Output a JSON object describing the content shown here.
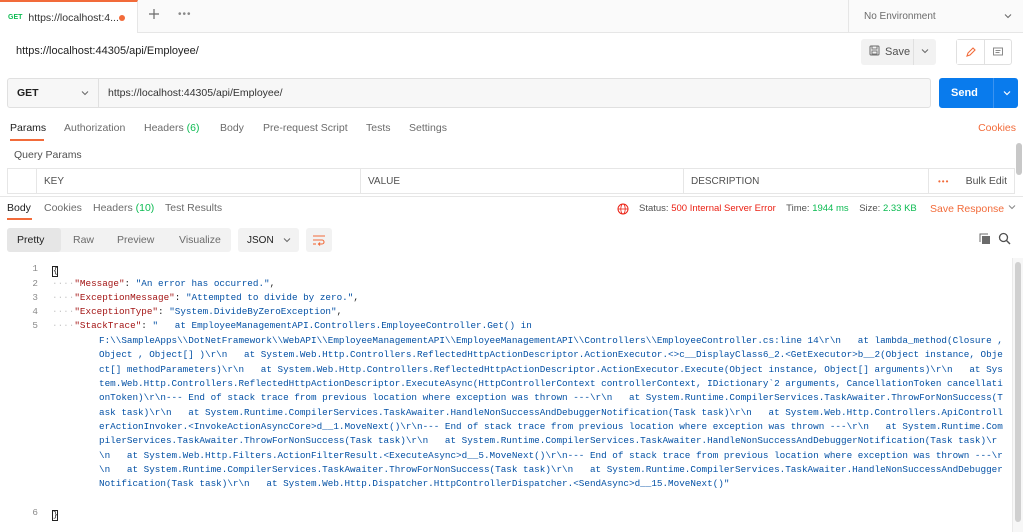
{
  "tab": {
    "method": "GET",
    "url": "https://localhost:4...",
    "more": "•••"
  },
  "environment": "No Environment",
  "title": "https://localhost:44305/api/Employee/",
  "save_label": "Save",
  "method": "GET",
  "url": "https://localhost:44305/api/Employee/",
  "send_label": "Send",
  "request_tabs": {
    "params": "Params",
    "authorization": "Authorization",
    "headers": "Headers",
    "headers_count": "(6)",
    "body": "Body",
    "prerequest": "Pre-request Script",
    "tests": "Tests",
    "settings": "Settings",
    "cookies": "Cookies"
  },
  "query_params_title": "Query Params",
  "params_table": {
    "key": "KEY",
    "value": "VALUE",
    "description": "DESCRIPTION",
    "more": "•••",
    "bulk_edit": "Bulk Edit"
  },
  "response_tabs": {
    "body": "Body",
    "cookies": "Cookies",
    "headers": "Headers",
    "headers_count": "(10)",
    "test_results": "Test Results"
  },
  "status": {
    "status_label": "Status:",
    "status_value": "500 Internal Server Error",
    "time_label": "Time:",
    "time_value": "1944 ms",
    "size_label": "Size:",
    "size_value": "2.33 KB",
    "save_response": "Save Response"
  },
  "format_buttons": {
    "pretty": "Pretty",
    "raw": "Raw",
    "preview": "Preview",
    "visualize": "Visualize"
  },
  "format_select": "JSON",
  "response": {
    "line_numbers": [
      "1",
      "2",
      "3",
      "4",
      "5",
      "6"
    ],
    "brace_open": "{",
    "brace_close": "}",
    "indent": "····",
    "message_key": "\"Message\"",
    "message_value": "\"An error has occurred.\"",
    "exmsg_key": "\"ExceptionMessage\"",
    "exmsg_value": "\"Attempted to divide by zero.\"",
    "extype_key": "\"ExceptionType\"",
    "extype_value": "\"System.DivideByZeroException\"",
    "trace_key": "\"StackTrace\"",
    "trace_line1": "\"   at EmployeeManagementAPI.Controllers.EmployeeController.Get() in",
    "trace_rest": "F:\\\\SampleApps\\\\DotNetFramework\\\\WebAPI\\\\EmployeeManagementAPI\\\\EmployeeManagementAPI\\\\Controllers\\\\EmployeeController.cs:line 14\\r\\n   at lambda_method(Closure , Object , Object[] )\\r\\n   at System.Web.Http.Controllers.ReflectedHttpActionDescriptor.ActionExecutor.<>c__DisplayClass6_2.<GetExecutor>b__2(Object instance, Object[] methodParameters)\\r\\n   at System.Web.Http.Controllers.ReflectedHttpActionDescriptor.ActionExecutor.Execute(Object instance, Object[] arguments)\\r\\n   at System.Web.Http.Controllers.ReflectedHttpActionDescriptor.ExecuteAsync(HttpControllerContext controllerContext, IDictionary`2 arguments, CancellationToken cancellationToken)\\r\\n--- End of stack trace from previous location where exception was thrown ---\\r\\n   at System.Runtime.CompilerServices.TaskAwaiter.ThrowForNonSuccess(Task task)\\r\\n   at System.Runtime.CompilerServices.TaskAwaiter.HandleNonSuccessAndDebuggerNotification(Task task)\\r\\n   at System.Web.Http.Controllers.ApiControllerActionInvoker.<InvokeActionAsyncCore>d__1.MoveNext()\\r\\n--- End of stack trace from previous location where exception was thrown ---\\r\\n   at System.Runtime.CompilerServices.TaskAwaiter.ThrowForNonSuccess(Task task)\\r\\n   at System.Runtime.CompilerServices.TaskAwaiter.HandleNonSuccessAndDebuggerNotification(Task task)\\r\\n   at System.Web.Http.Filters.ActionFilterResult.<ExecuteAsync>d__5.MoveNext()\\r\\n--- End of stack trace from previous location where exception was thrown ---\\r\\n   at System.Runtime.CompilerServices.TaskAwaiter.ThrowForNonSuccess(Task task)\\r\\n   at System.Runtime.CompilerServices.TaskAwaiter.HandleNonSuccessAndDebuggerNotification(Task task)\\r\\n   at System.Web.Http.Dispatcher.HttpControllerDispatcher.<SendAsync>d__15.MoveNext()\""
  },
  "colors": {
    "accent": "#f26b3a",
    "send": "#097bed",
    "success": "#0cbb52",
    "error": "#eb2013",
    "json_key": "#a31515",
    "json_string": "#0451a5"
  },
  "icons": [
    "plus-icon",
    "chevron-down-icon",
    "save-icon",
    "edit-icon",
    "comment-icon",
    "globe-icon",
    "wrap-icon",
    "copy-icon",
    "search-icon"
  ]
}
